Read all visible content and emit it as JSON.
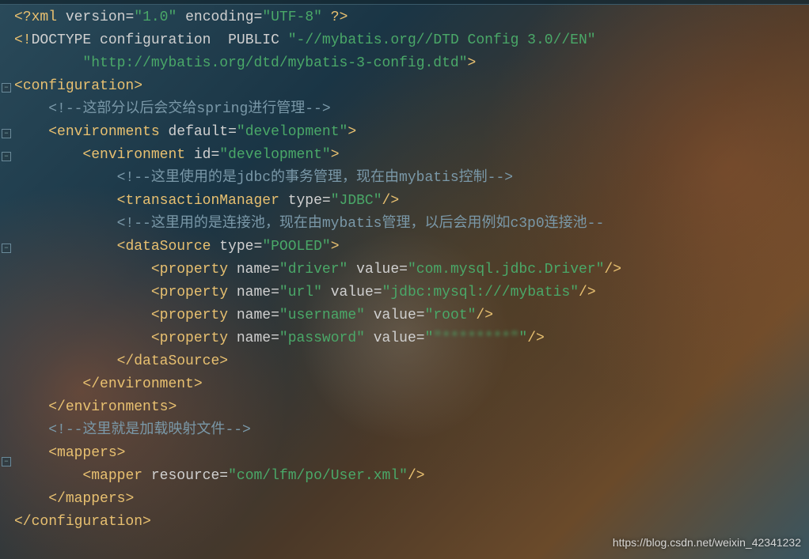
{
  "xml_decl": {
    "version_attr": "version",
    "version_val": "\"1.0\"",
    "encoding_attr": "encoding",
    "encoding_val": "\"UTF-8\""
  },
  "doctype": {
    "kw": "DOCTYPE",
    "root": "configuration",
    "pub": "PUBLIC",
    "fpi": "\"-//mybatis.org//DTD Config 3.0//EN\"",
    "uri": "\"http://mybatis.org/dtd/mybatis-3-config.dtd\""
  },
  "tags": {
    "configuration": "configuration",
    "environments": "environments",
    "environment": "environment",
    "transactionManager": "transactionManager",
    "dataSource": "dataSource",
    "property": "property",
    "mappers": "mappers",
    "mapper": "mapper"
  },
  "attrs": {
    "default": "default",
    "id": "id",
    "type": "type",
    "name": "name",
    "value": "value",
    "resource": "resource"
  },
  "vals": {
    "development": "\"development\"",
    "JDBC": "\"JDBC\"",
    "POOLED": "\"POOLED\"",
    "driver_name": "\"driver\"",
    "driver_val": "\"com.mysql.jdbc.Driver\"",
    "url_name": "\"url\"",
    "url_val": "\"jdbc:mysql:///mybatis\"",
    "user_name": "\"username\"",
    "user_val": "\"root\"",
    "pass_name": "\"password\"",
    "pass_val": "\"********\"",
    "mapper_res": "\"com/lfm/po/User.xml\""
  },
  "comments": {
    "c1": "这部分以后会交给spring进行管理",
    "c2_pre": "这里使用的是jdbc的事务管理，现在由mybatis控制",
    "c3_pre": "这里用的是连接池，现在由mybatis管理，以后会用例如c3p0连接池",
    "c4": "这里就是加载映射文件"
  },
  "watermark": "https://blog.csdn.net/weixin_42341232"
}
